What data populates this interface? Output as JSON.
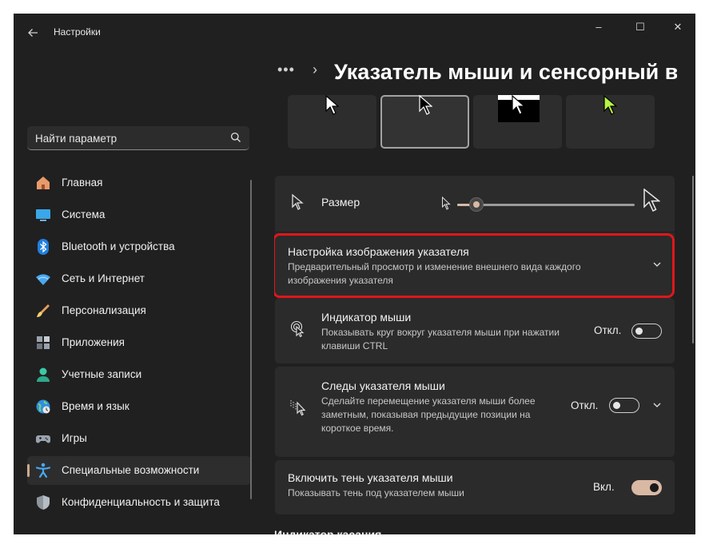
{
  "app": {
    "title": "Настройки"
  },
  "window_controls": {
    "minimize": "–",
    "maximize": "☐",
    "close": "✕"
  },
  "search": {
    "placeholder": "Найти параметр"
  },
  "sidebar": {
    "items": [
      {
        "label": "Главная",
        "icon": "home-icon"
      },
      {
        "label": "Система",
        "icon": "system-icon"
      },
      {
        "label": "Bluetooth и устройства",
        "icon": "bluetooth-icon"
      },
      {
        "label": "Сеть и Интернет",
        "icon": "wifi-icon"
      },
      {
        "label": "Персонализация",
        "icon": "brush-icon"
      },
      {
        "label": "Приложения",
        "icon": "apps-icon"
      },
      {
        "label": "Учетные записи",
        "icon": "account-icon"
      },
      {
        "label": "Время и язык",
        "icon": "globe-icon"
      },
      {
        "label": "Игры",
        "icon": "gamepad-icon"
      },
      {
        "label": "Специальные возможности",
        "icon": "accessibility-icon",
        "active": true
      },
      {
        "label": "Конфиденциальность и защита",
        "icon": "shield-icon"
      }
    ]
  },
  "breadcrumb": {
    "dots": "•••",
    "separator": "›",
    "title": "Указатель мыши и сенсорный ввод"
  },
  "pointer_styles": {
    "selected_index": 1,
    "options": [
      "white-pointer",
      "black-pointer",
      "inverted-pointer",
      "custom-color-pointer"
    ],
    "custom_color": "#b5f542"
  },
  "size_row": {
    "title": "Размер",
    "slider_value_fraction": 0.11
  },
  "pointer_image_row": {
    "title": "Настройка изображения указателя",
    "subtitle": "Предварительный просмотр и изменение внешнего вида каждого изображения указателя"
  },
  "mouse_indicator_row": {
    "title": "Индикатор мыши",
    "subtitle": "Показывать круг вокруг указателя мыши при нажатии клавиши CTRL",
    "state_label": "Откл.",
    "on": false
  },
  "trails_row": {
    "title": "Следы указателя мыши",
    "subtitle": "Сделайте перемещение указателя мыши более заметным, показывая предыдущие позиции на короткое время.",
    "state_label": "Откл.",
    "on": false
  },
  "shadow_row": {
    "title": "Включить тень указателя мыши",
    "subtitle": "Показывать тень под указателем мыши",
    "state_label": "Вкл.",
    "on": true
  },
  "next_section": {
    "title": "Индикатор касания"
  },
  "colors": {
    "accent": "#d9b9a4",
    "highlight": "#e0161b"
  }
}
